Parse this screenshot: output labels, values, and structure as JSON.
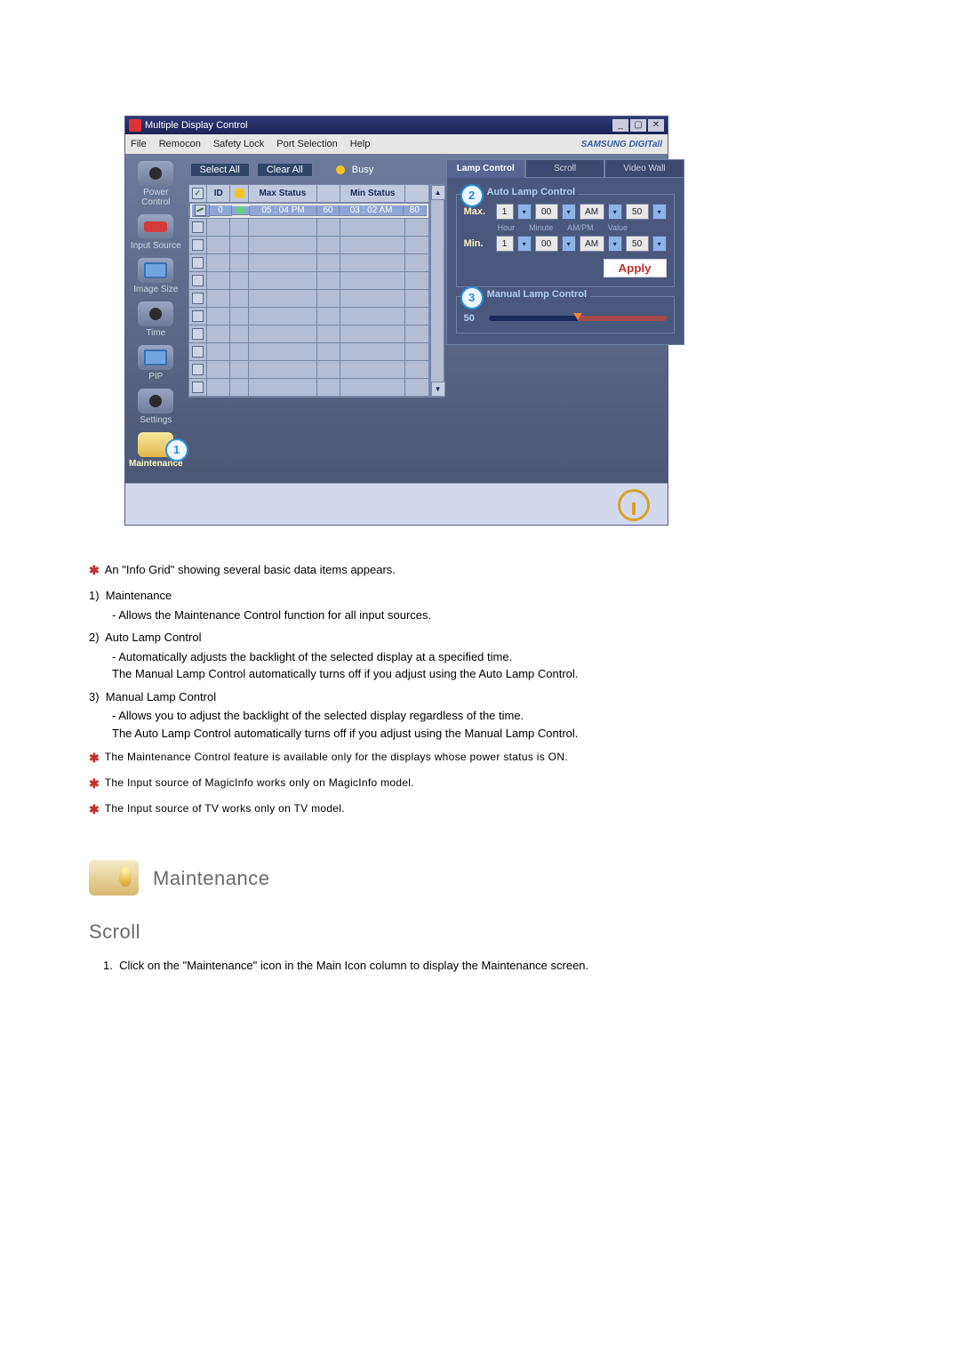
{
  "app": {
    "title": "Multiple Display Control",
    "brand": "SAMSUNG DIGITall",
    "menubar": [
      "File",
      "Remocon",
      "Safety Lock",
      "Port Selection",
      "Help"
    ],
    "win_btns": [
      "_",
      "▢",
      "✕"
    ],
    "buttons": {
      "select_all": "Select All",
      "clear_all": "Clear All"
    },
    "busy": {
      "label": "Busy"
    },
    "sidebar": [
      {
        "label": "Power Control"
      },
      {
        "label": "Input Source"
      },
      {
        "label": "Image Size"
      },
      {
        "label": "Time"
      },
      {
        "label": "PIP"
      },
      {
        "label": "Settings"
      },
      {
        "label": "Maintenance",
        "callout": "1"
      }
    ],
    "grid": {
      "headers": {
        "chk": "",
        "id": "ID",
        "dot": "",
        "max": "Max Status",
        "mv": "",
        "min": "Min Status",
        "nv": ""
      },
      "rows": [
        {
          "checked": true,
          "id": "0",
          "max": "05 : 04 PM",
          "mv": "60",
          "min": "03 : 02 AM",
          "nv": "80",
          "dottype": true,
          "selected": true
        }
      ],
      "blank_rows": 10,
      "header_chk_checked": true
    },
    "tabs": [
      "Lamp Control",
      "Scroll",
      "Video Wall"
    ],
    "auto_lamp": {
      "legend": "Auto Lamp Control",
      "callout": "2",
      "sub_labels": [
        "Hour",
        "Minute",
        "AM/PM",
        "Value"
      ],
      "rows": [
        {
          "lbl": "Max.",
          "hour": "1",
          "minute": "00",
          "ampm": "AM",
          "value": "50"
        },
        {
          "lbl": "Min.",
          "hour": "1",
          "minute": "00",
          "ampm": "AM",
          "value": "50"
        }
      ],
      "apply": "Apply"
    },
    "manual_lamp": {
      "legend": "Manual Lamp Control",
      "callout": "3",
      "value": "50"
    }
  },
  "doc": {
    "intro": "An \"Info Grid\" showing several basic data items appears.",
    "items": [
      {
        "num": "1)",
        "title": "Maintenance",
        "lines": [
          "- Allows the Maintenance Control function for all input sources."
        ]
      },
      {
        "num": "2)",
        "title": "Auto Lamp Control",
        "lines": [
          "- Automatically adjusts the backlight of the selected display at a specified time.",
          "The Manual Lamp Control automatically turns off if you adjust using the Auto Lamp Control."
        ]
      },
      {
        "num": "3)",
        "title": "Manual Lamp Control",
        "lines": [
          "- Allows you to adjust the backlight of the selected display regardless of the time.",
          "The Auto Lamp Control automatically turns off if you adjust using the Manual Lamp Control."
        ]
      }
    ],
    "notes": [
      "The Maintenance Control feature is available only for the displays whose power status is ON.",
      "The Input source of MagicInfo works only on MagicInfo model.",
      "The Input source of TV works only on TV model."
    ],
    "section_heading": "Maintenance",
    "subsection_heading": "Scroll",
    "step1": "Click on the \"Maintenance\" icon in the Main Icon column to display the Maintenance screen."
  }
}
